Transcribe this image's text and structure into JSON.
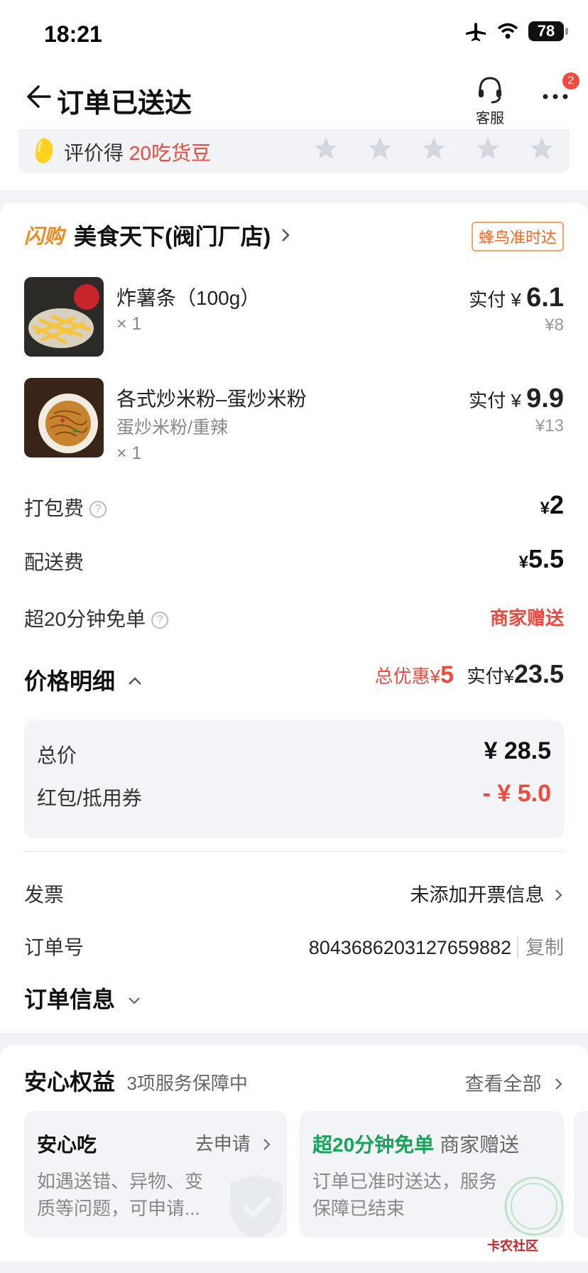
{
  "status_bar": {
    "time": "18:21",
    "battery": "78"
  },
  "nav": {
    "title": "订单已送达",
    "service_label": "客服",
    "badge_count": "2"
  },
  "rating": {
    "prefix": "评价得",
    "highlight": "20吃货豆",
    "stars": 5
  },
  "shop": {
    "tag": "闪购",
    "name": "美食天下(阀门厂店)",
    "delivery_badge": "蜂鸟准时达"
  },
  "items": [
    {
      "name": "炸薯条（100g）",
      "qty": "× 1",
      "paid_label": "实付",
      "currency": "¥",
      "paid": "6.1",
      "original": "¥8"
    },
    {
      "name": "各式炒米粉–蛋炒米粉",
      "spec": "蛋炒米粉/重辣",
      "qty": "× 1",
      "paid_label": "实付",
      "currency": "¥",
      "paid": "9.9",
      "original": "¥13"
    }
  ],
  "fees": {
    "packing_label": "打包费",
    "packing_value": "2",
    "delivery_label": "配送费",
    "delivery_value": "5.5",
    "free_label": "超20分钟免单",
    "free_value": "商家赠送",
    "currency": "¥",
    "help_mark": "?"
  },
  "price": {
    "title": "价格明细",
    "discount_label": "总优惠¥",
    "discount_value": "5",
    "paid_label": "实付¥",
    "paid_value": "23.5",
    "total_label": "总价",
    "total_value": "¥ 28.5",
    "coupon_label": "红包/抵用券",
    "coupon_value": "- ¥ 5.0"
  },
  "invoice": {
    "label": "发票",
    "value": "未添加开票信息"
  },
  "order_no": {
    "label": "订单号",
    "value": "8043686203127659882",
    "copy": "复制"
  },
  "order_info": {
    "label": "订单信息"
  },
  "assurance": {
    "title": "安心权益",
    "count": "3项服务保障中",
    "view_all": "查看全部",
    "cards": [
      {
        "title": "安心吃",
        "action": "去申请",
        "desc": "如遇送错、异物、变质等问题，可申请..."
      },
      {
        "title": "超20分钟免单",
        "title_suffix": "商家赠送",
        "desc": "订单已准时送达，服务保障已结束"
      }
    ]
  },
  "watermark": "卡农社区",
  "colors": {
    "accent_red": "#f04a3e",
    "orange": "#f08a1c",
    "green": "#17a55a"
  }
}
